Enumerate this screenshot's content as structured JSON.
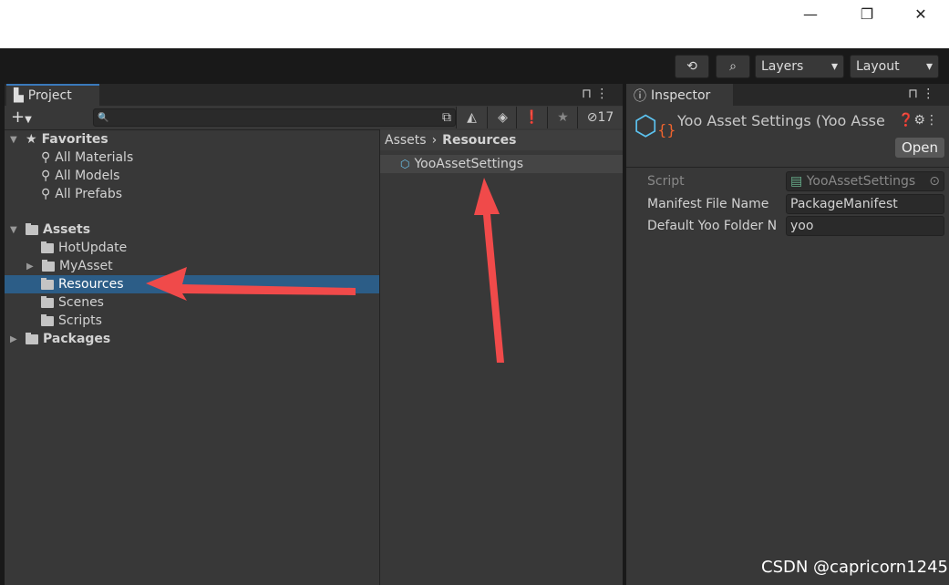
{
  "window": {
    "minimize": "—",
    "restore": "❐",
    "close": "✕"
  },
  "toolbar": {
    "layers": "Layers",
    "layout": "Layout"
  },
  "project": {
    "tab": "Project",
    "filter_count": "17",
    "search_placeholder": "",
    "favorites": {
      "label": "Favorites",
      "items": [
        "All Materials",
        "All Models",
        "All Prefabs"
      ]
    },
    "assets": {
      "label": "Assets",
      "items": [
        "HotUpdate",
        "MyAsset",
        "Resources",
        "Scenes",
        "Scripts"
      ]
    },
    "packages": "Packages",
    "breadcrumb": [
      "Assets",
      "Resources"
    ],
    "files": [
      "YooAssetSettings"
    ]
  },
  "inspector": {
    "tab": "Inspector",
    "title": "Yoo Asset Settings (Yoo Asse",
    "open": "Open",
    "fields": [
      {
        "label": "Script",
        "value": "YooAssetSettings"
      },
      {
        "label": "Manifest File Name",
        "value": "PackageManifest"
      },
      {
        "label": "Default Yoo Folder N",
        "value": "yoo"
      }
    ]
  },
  "watermark": "CSDN @capricorn1245",
  "colors": {
    "selection": "#2c5d87",
    "arrow": "#f04a4a"
  }
}
